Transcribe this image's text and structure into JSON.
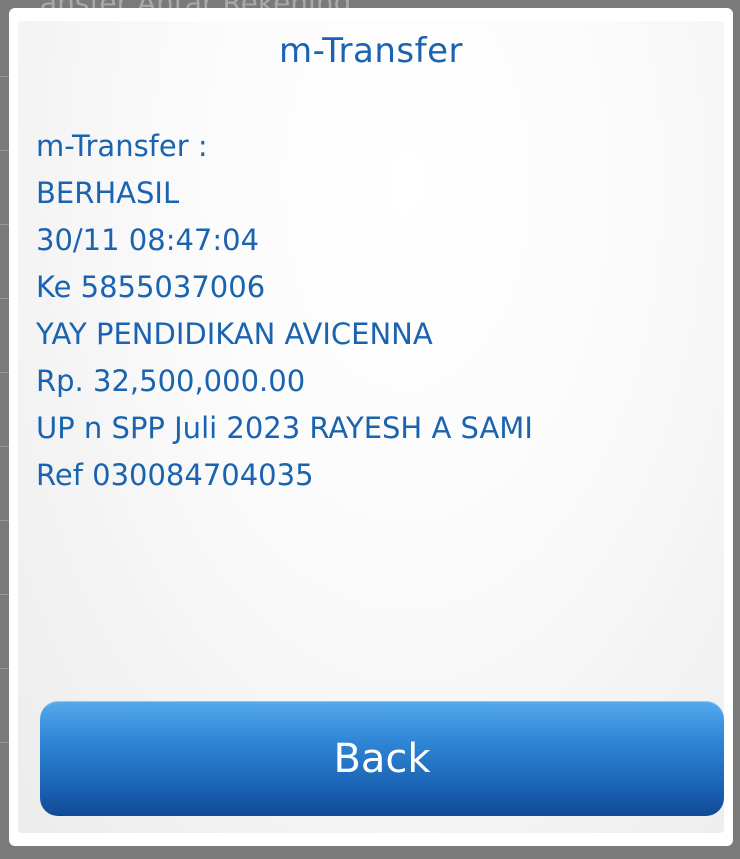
{
  "background": {
    "title": "ansfer Antar Rekening"
  },
  "dialog": {
    "title": "m-Transfer",
    "message_lines": [
      "m-Transfer :",
      "BERHASIL",
      "30/11 08:47:04",
      "Ke 5855037006",
      "YAY PENDIDIKAN AVICENNA",
      "Rp. 32,500,000.00",
      "UP n SPP Juli 2023 RAYESH A SAMI",
      "Ref 030084704035"
    ],
    "back_label": "Back"
  },
  "colors": {
    "accent_text": "#1a63b0",
    "button_top": "#56a9ec",
    "button_bottom": "#114a94",
    "overlay": "#6e6e6e"
  }
}
